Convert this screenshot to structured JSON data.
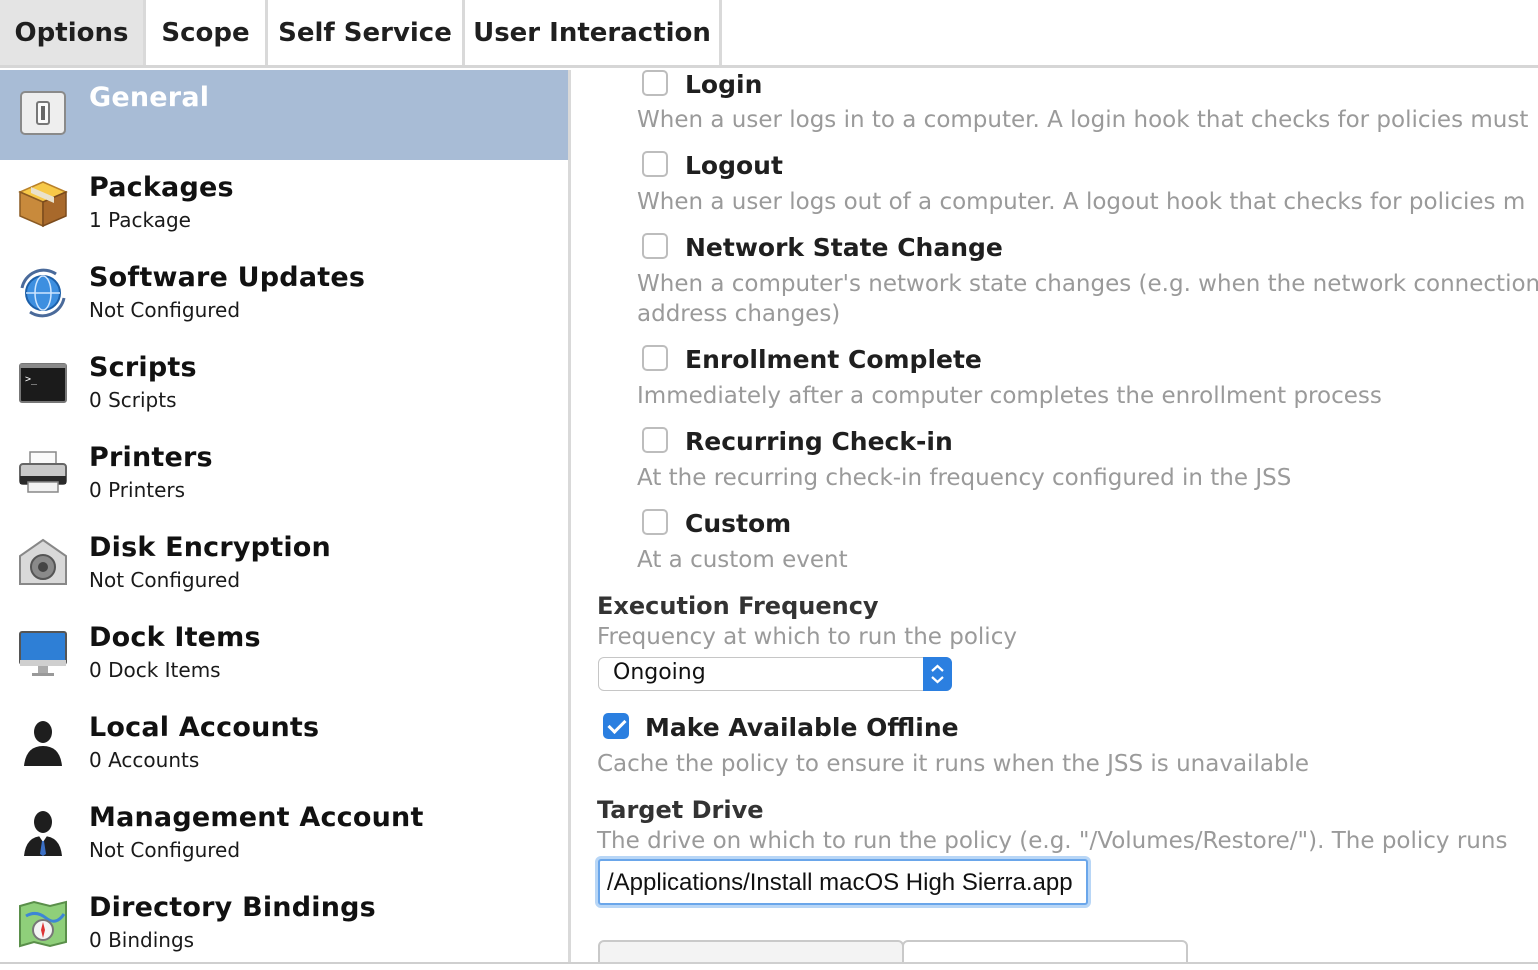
{
  "tabs": [
    {
      "label": "Options",
      "active": true
    },
    {
      "label": "Scope",
      "active": false
    },
    {
      "label": "Self Service",
      "active": false
    },
    {
      "label": "User Interaction",
      "active": false
    }
  ],
  "sidebar": {
    "items": [
      {
        "title": "General",
        "subtitle": "",
        "icon": "switch-icon",
        "selected": true
      },
      {
        "title": "Packages",
        "subtitle": "1 Package",
        "icon": "package-icon"
      },
      {
        "title": "Software Updates",
        "subtitle": "Not Configured",
        "icon": "software-update-icon"
      },
      {
        "title": "Scripts",
        "subtitle": "0 Scripts",
        "icon": "terminal-icon"
      },
      {
        "title": "Printers",
        "subtitle": "0 Printers",
        "icon": "printer-icon"
      },
      {
        "title": "Disk Encryption",
        "subtitle": "Not Configured",
        "icon": "disk-encryption-icon"
      },
      {
        "title": "Dock Items",
        "subtitle": "0 Dock Items",
        "icon": "monitor-icon"
      },
      {
        "title": "Local Accounts",
        "subtitle": "0 Accounts",
        "icon": "user-icon"
      },
      {
        "title": "Management Account",
        "subtitle": "Not Configured",
        "icon": "admin-user-icon"
      },
      {
        "title": "Directory Bindings",
        "subtitle": "0 Bindings",
        "icon": "map-compass-icon"
      }
    ]
  },
  "triggers": [
    {
      "label": "Login",
      "desc": "When a user logs in to a computer. A login hook that checks for policies must",
      "checked": false
    },
    {
      "label": "Logout",
      "desc": "When a user logs out of a computer. A logout hook that checks for policies m",
      "checked": false
    },
    {
      "label": "Network State Change",
      "desc": "When a computer's network state changes (e.g. when the network connection",
      "desc2": "address changes)",
      "checked": false
    },
    {
      "label": "Enrollment Complete",
      "desc": "Immediately after a computer completes the enrollment process",
      "checked": false
    },
    {
      "label": "Recurring Check-in",
      "desc": "At the recurring check-in frequency configured in the JSS",
      "checked": false
    },
    {
      "label": "Custom",
      "desc": "At a custom event",
      "checked": false
    }
  ],
  "execution_frequency": {
    "label": "Execution Frequency",
    "desc": "Frequency at which to run the policy",
    "value": "Ongoing"
  },
  "offline": {
    "label": "Make Available Offline",
    "desc": "Cache the policy to ensure it runs when the JSS is unavailable",
    "checked": true
  },
  "target_drive": {
    "label": "Target Drive",
    "desc": "The drive on which to run the policy (e.g. \"/Volumes/Restore/\"). The policy runs",
    "value": "/Applications/Install macOS High Sierra.app"
  },
  "colors": {
    "selected_bg": "#a8bcd6",
    "accent": "#2b7fe0"
  }
}
